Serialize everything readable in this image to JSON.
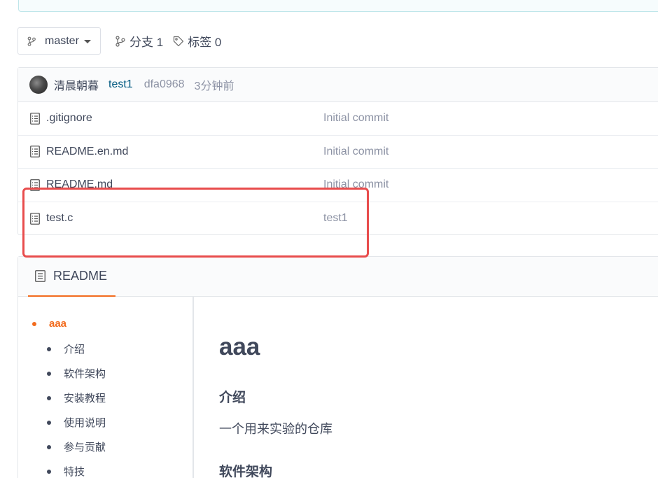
{
  "branch": {
    "name": "master"
  },
  "stats": {
    "branches_label": "分支 1",
    "tags_label": "标签 0"
  },
  "latest_commit": {
    "author": "清晨朝暮",
    "message": "test1",
    "sha": "dfa0968",
    "time": "3分钟前"
  },
  "files": [
    {
      "name": ".gitignore",
      "commit": "Initial commit"
    },
    {
      "name": "README.en.md",
      "commit": "Initial commit"
    },
    {
      "name": "README.md",
      "commit": "Initial commit"
    },
    {
      "name": "test.c",
      "commit": "test1"
    }
  ],
  "readme": {
    "tab_label": "README",
    "toc": [
      "aaa",
      "介绍",
      "软件架构",
      "安装教程",
      "使用说明",
      "参与贡献",
      "特技"
    ],
    "title": "aaa",
    "intro_heading": "介绍",
    "intro_text": "一个用来实验的仓库",
    "arch_heading": "软件架构"
  },
  "colors": {
    "accent": "#f26b1d",
    "highlight": "#e84c4c",
    "link": "#005980"
  }
}
